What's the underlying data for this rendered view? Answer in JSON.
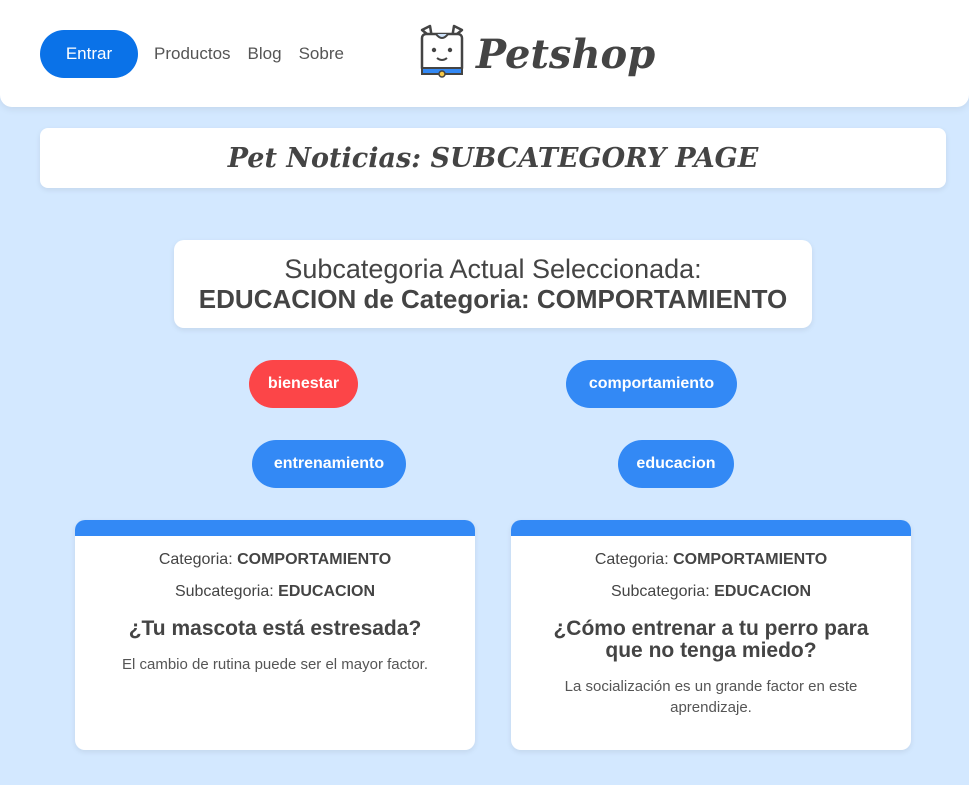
{
  "nav": {
    "login_label": "Entrar",
    "links": [
      "Productos",
      "Blog",
      "Sobre"
    ],
    "brand_name": "Petshop",
    "brand_icon": "dog-logo-icon"
  },
  "page": {
    "title": "Pet Noticias: SUBCATEGORY PAGE"
  },
  "current": {
    "line1": "Subcategoria Actual Seleccionada:",
    "line2": "EDUCACION de Categoria: COMPORTAMIENTO"
  },
  "subcategories": [
    "bienestar",
    "comportamiento",
    "entrenamiento",
    "educacion"
  ],
  "colors": {
    "primary": "#0a72e8",
    "pill_blue": "#3389f5",
    "pill_red": "#fc4548",
    "background": "#d3e8ff"
  },
  "cards": [
    {
      "category_label": "Categoria:",
      "category_value": "COMPORTAMIENTO",
      "subcategory_label": "Subcategoria:",
      "subcategory_value": "EDUCACION",
      "title": "¿Tu mascota está estresada?",
      "description": "El cambio de rutina puede ser el mayor factor."
    },
    {
      "category_label": "Categoria:",
      "category_value": "COMPORTAMIENTO",
      "subcategory_label": "Subcategoria:",
      "subcategory_value": "EDUCACION",
      "title": "¿Cómo entrenar a tu perro para que no tenga miedo?",
      "description": "La socialización es un grande factor en este aprendizaje."
    }
  ]
}
